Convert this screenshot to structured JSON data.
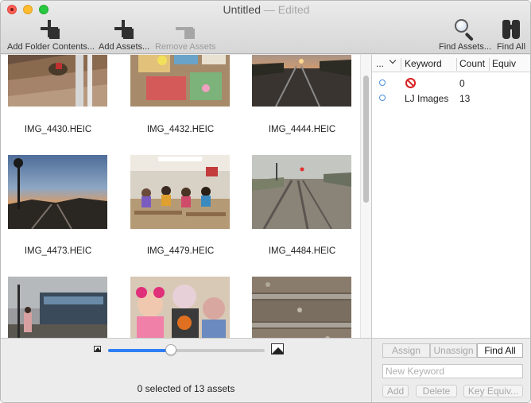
{
  "window": {
    "title": "Untitled",
    "title_suffix": "— Edited"
  },
  "toolbar": {
    "add_folder_label": "Add Folder Contents...",
    "add_assets_label": "Add Assets...",
    "remove_assets_label": "Remove Assets",
    "find_assets_label": "Find Assets...",
    "find_all_label": "Find All"
  },
  "assets": [
    {
      "name": "IMG_4430.HEIC"
    },
    {
      "name": "IMG_4432.HEIC"
    },
    {
      "name": "IMG_4444.HEIC"
    },
    {
      "name": "IMG_4473.HEIC"
    },
    {
      "name": "IMG_4479.HEIC"
    },
    {
      "name": "IMG_4484.HEIC"
    },
    {
      "name": ""
    },
    {
      "name": ""
    },
    {
      "name": ""
    }
  ],
  "zoom": {
    "level": 0.4
  },
  "status": {
    "text": "0 selected of 13 assets"
  },
  "keywords": {
    "columns": {
      "menu": "...",
      "keyword": "Keyword",
      "count": "Count",
      "equiv": "Equiv"
    },
    "rows": [
      {
        "label": "",
        "count": "0",
        "icon": "no-entry-icon"
      },
      {
        "label": "LJ Images",
        "count": "13"
      }
    ],
    "buttons": {
      "assign": "Assign",
      "unassign": "Unassign",
      "find_all": "Find All",
      "add": "Add",
      "delete": "Delete",
      "key_equiv": "Key Equiv..."
    },
    "new_keyword_placeholder": "New Keyword"
  },
  "colors": {
    "accent": "#2f7ef5"
  }
}
